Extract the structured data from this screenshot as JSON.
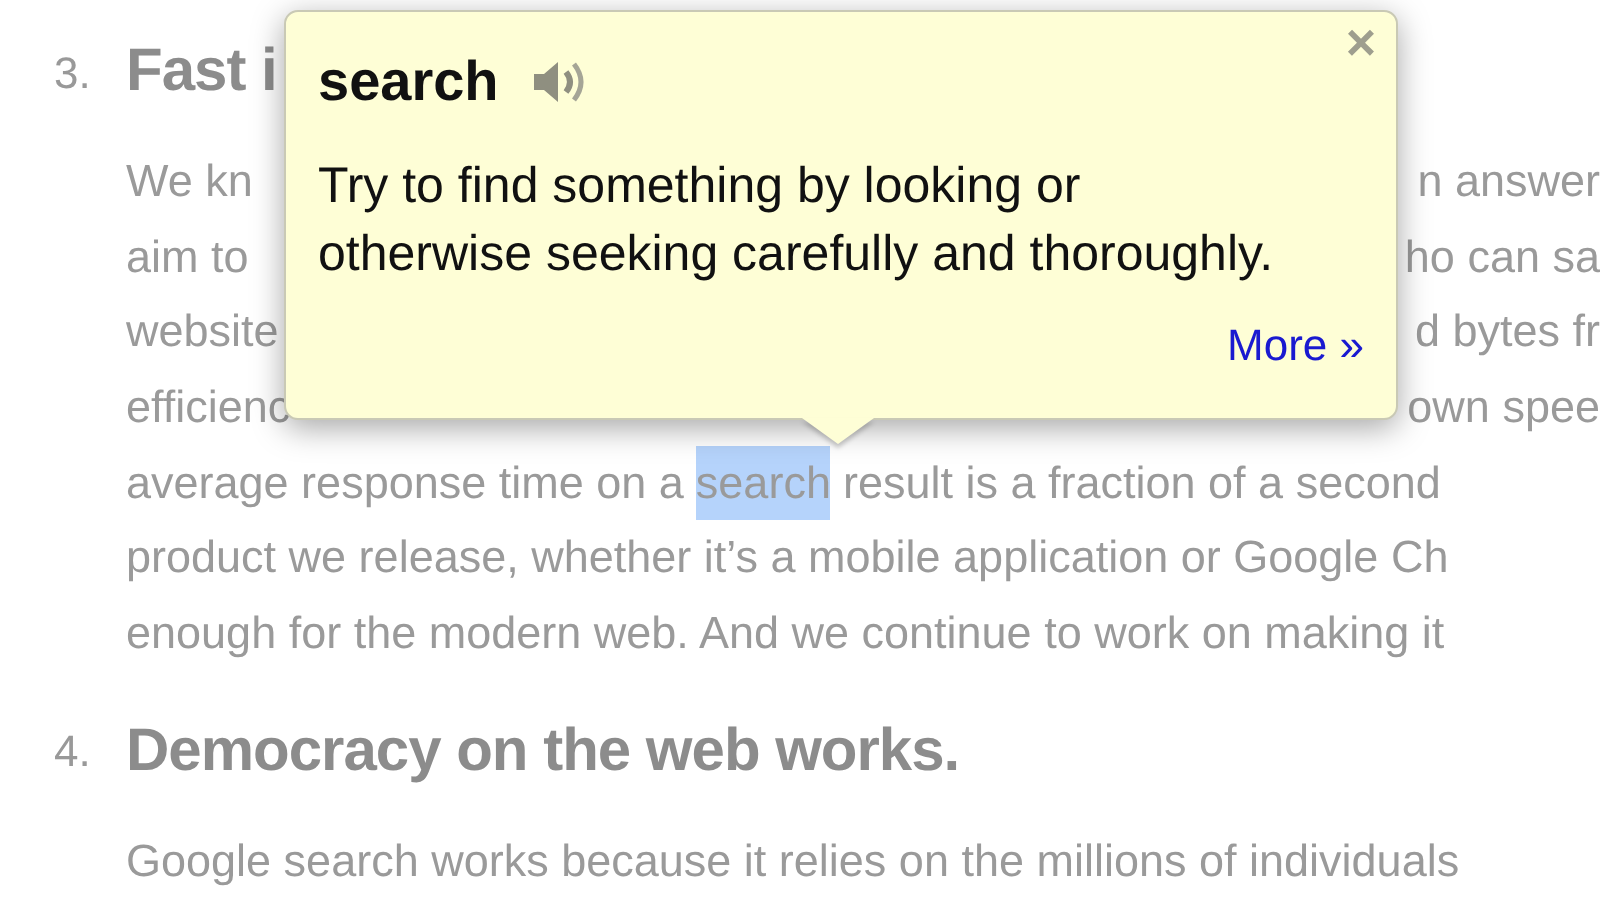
{
  "article": {
    "sections": [
      {
        "number": "3.",
        "heading": "Fast i",
        "lines": [
          {
            "kind": "split",
            "left": "We kn",
            "right": "n answer"
          },
          {
            "kind": "split",
            "left": "aim to",
            "right": "ho can sa"
          },
          {
            "kind": "split",
            "left": "website",
            "right": "d bytes fr"
          },
          {
            "kind": "split",
            "left": "efficienc",
            "right": "own spee"
          },
          {
            "kind": "flow",
            "segments": [
              {
                "text": "average response time on a",
                "selected": false
              },
              {
                "text": "search",
                "selected": true
              },
              {
                "text": "result is a fraction of a second",
                "selected": false
              }
            ]
          },
          {
            "kind": "flow",
            "segments": [
              {
                "text": "product we release, whether it’s a mobile application or Google Ch",
                "selected": false
              }
            ]
          },
          {
            "kind": "flow",
            "segments": [
              {
                "text": "enough for the modern web. And we continue to work on making it",
                "selected": false
              }
            ]
          }
        ]
      },
      {
        "number": "4.",
        "heading": "Democracy on the web works.",
        "lines": [
          {
            "kind": "flow",
            "segments": [
              {
                "text": "Google search works because it relies on the millions of individuals",
                "selected": false
              }
            ]
          }
        ]
      }
    ]
  },
  "popup": {
    "word": "search",
    "definition": "Try to find something by looking or otherwise seeking carefully and thoroughly.",
    "more_link": "More »",
    "close": "×"
  }
}
